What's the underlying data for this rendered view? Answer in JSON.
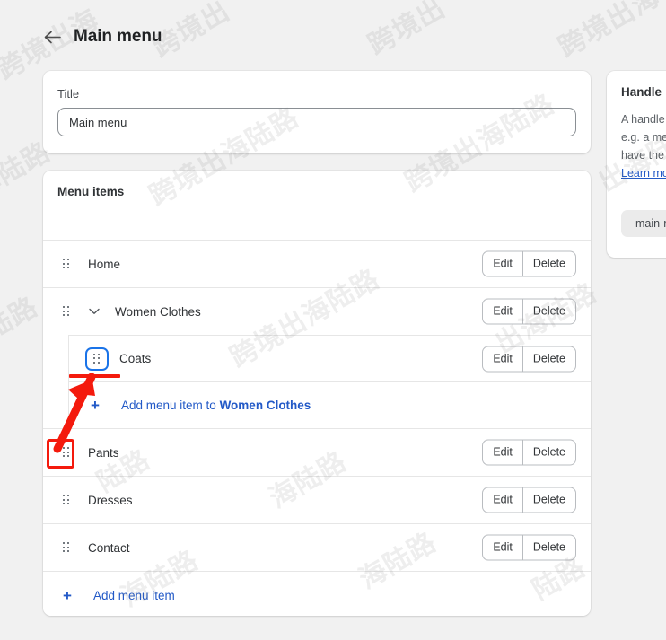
{
  "page": {
    "title": "Main menu",
    "back_icon": "arrow-left-icon",
    "background_color": "#f1f1f1"
  },
  "title_card": {
    "label": "Title",
    "input_value": "Main menu",
    "input_placeholder": "Main menu"
  },
  "menu_card": {
    "heading": "Menu items",
    "edit_label": "Edit",
    "delete_label": "Delete",
    "drag_handle_icon": "drag-handle-icon",
    "chevron_icon": "chevron-down-icon",
    "plus_icon": "plus-icon",
    "items": [
      {
        "label": "Home",
        "level": 0,
        "expandable": false,
        "handle_focused": false
      },
      {
        "label": "Women Clothes",
        "level": 0,
        "expandable": true,
        "handle_focused": false
      },
      {
        "label": "Coats",
        "level": 1,
        "expandable": false,
        "handle_focused": true
      },
      {
        "label": "Pants",
        "level": 0,
        "expandable": false,
        "handle_focused": false
      },
      {
        "label": "Dresses",
        "level": 0,
        "expandable": false,
        "handle_focused": false
      },
      {
        "label": "Contact",
        "level": 0,
        "expandable": false,
        "handle_focused": false
      }
    ],
    "add_nested": {
      "prefix": "Add menu item to ",
      "target": "Women Clothes"
    },
    "add_bottom_label": "Add menu item"
  },
  "handle_card": {
    "title": "Handle",
    "line1": "A handle",
    "line2": "e.g. a me",
    "line3": "have the",
    "learn_more": "Learn mo",
    "chip_value": "main-n"
  },
  "annotations": {
    "accent_color": "#f41a0d",
    "focus_ring_color": "#1a73e8",
    "link_color": "#2259c7"
  },
  "watermark": {
    "text_a": "跨境出海陆路",
    "text_b": "跨境出海",
    "text_c": "海陆路",
    "text_d": "出海陆路",
    "text_e": "跨境出",
    "text_f": "陆路"
  }
}
